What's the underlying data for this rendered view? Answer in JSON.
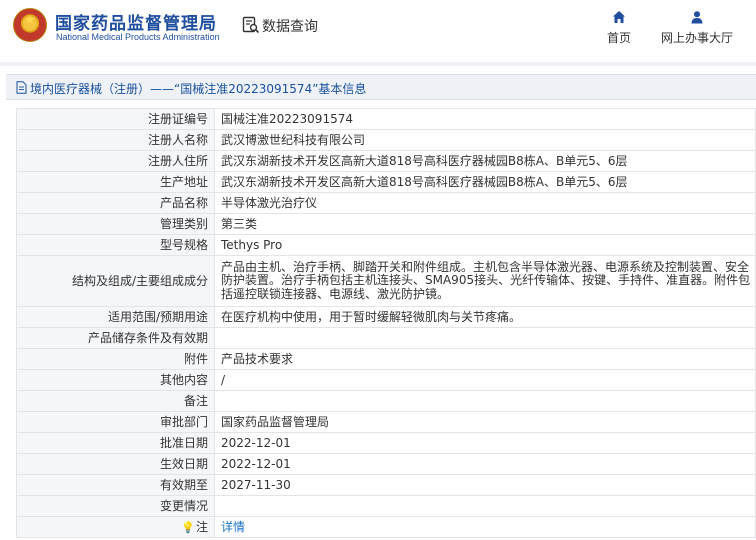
{
  "header": {
    "org_name_cn": "国家药品监督管理局",
    "org_name_en": "National Medical Products Administration",
    "query_title": "数据查询",
    "nav": [
      {
        "label": "首页",
        "icon": "home-icon"
      },
      {
        "label": "网上办事大厅",
        "icon": "user-icon"
      }
    ]
  },
  "title_bar": {
    "text": "境内医疗器械（注册）——“国械注准20223091574”基本信息",
    "icon": "document-icon"
  },
  "details": {
    "rows": [
      {
        "label": "注册证编号",
        "value": "国械注准20223091574"
      },
      {
        "label": "注册人名称",
        "value": "武汉博激世纪科技有限公司"
      },
      {
        "label": "注册人住所",
        "value": "武汉东湖新技术开发区高新大道818号高科医疗器械园B8栋A、B单元5、6层"
      },
      {
        "label": "生产地址",
        "value": "武汉东湖新技术开发区高新大道818号高科医疗器械园B8栋A、B单元5、6层"
      },
      {
        "label": "产品名称",
        "value": "半导体激光治疗仪"
      },
      {
        "label": "管理类别",
        "value": "第三类"
      },
      {
        "label": "型号规格",
        "value": "Tethys Pro"
      },
      {
        "label": "结构及组成/主要组成成分",
        "value": "产品由主机、治疗手柄、脚踏开关和附件组成。主机包含半导体激光器、电源系统及控制装置、安全防护装置。治疗手柄包括主机连接头、SMA905接头、光纤传输体、按键、手持件、准直器。附件包括遥控联锁连接器、电源线、激光防护镜。"
      },
      {
        "label": "适用范围/预期用途",
        "value": "在医疗机构中使用，用于暂时缓解轻微肌肉与关节疼痛。"
      },
      {
        "label": "产品储存条件及有效期",
        "value": ""
      },
      {
        "label": "附件",
        "value": "产品技术要求"
      },
      {
        "label": "其他内容",
        "value": "/"
      },
      {
        "label": "备注",
        "value": ""
      },
      {
        "label": "审批部门",
        "value": "国家药品监督管理局"
      },
      {
        "label": "批准日期",
        "value": "2022-12-01"
      },
      {
        "label": "生效日期",
        "value": "2022-12-01"
      },
      {
        "label": "有效期至",
        "value": "2027-11-30"
      },
      {
        "label": "变更情况",
        "value": ""
      }
    ],
    "note": {
      "label": "注",
      "icon": "lightbulb-icon",
      "link": "详情"
    }
  },
  "colors": {
    "brand_blue": "#1f4e9e",
    "link_blue": "#1a73c8",
    "label_bg": "#f5f6f8",
    "title_bar_bg": "#eef2f7"
  }
}
